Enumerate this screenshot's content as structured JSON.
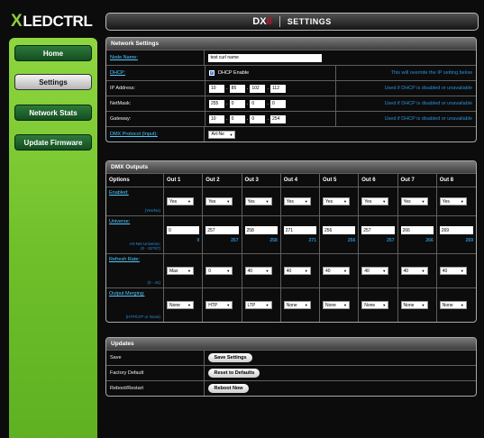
{
  "logo": {
    "x": "X",
    "text": "LEDCTRL"
  },
  "header": {
    "dx": "DX",
    "eight": "8",
    "title": "SETTINGS"
  },
  "nav": {
    "home": "Home",
    "settings": "Settings",
    "network_stats": "Network Stats",
    "update_firmware": "Update Firmware"
  },
  "network": {
    "title": "Network Settings",
    "node_name": {
      "label": "Node Name:",
      "value": "test curl name"
    },
    "dhcp": {
      "label": "DHCP:",
      "checkbox_label": "DHCP Enable",
      "checked": true,
      "note": "This will override the IP setting below"
    },
    "ip": {
      "label": "IP Address:",
      "octets": [
        "10",
        "85",
        "102",
        "112"
      ],
      "note": "Used if DHCP is disabled or unavailable"
    },
    "netmask": {
      "label": "NetMask:",
      "octets": [
        "255",
        "0",
        "0",
        "0"
      ],
      "note": "Used if DHCP is disabled or unavailable"
    },
    "gateway": {
      "label": "Gateway:",
      "octets": [
        "10",
        "0",
        "0",
        "254"
      ],
      "note": "Used if DHCP is disabled or unavailable"
    },
    "protocol": {
      "label": "DMX Protocol (Input):",
      "value": "Art-Ne"
    }
  },
  "dmx": {
    "title": "DMX Outputs",
    "options_header": "Options",
    "outputs": [
      "Out 1",
      "Out 2",
      "Out 3",
      "Out 4",
      "Out 5",
      "Out 6",
      "Out 7",
      "Out 8"
    ],
    "enabled": {
      "label": "Enabled:",
      "sub": "(Yes/No)",
      "values": [
        "Yes",
        "Yes",
        "Yes",
        "Yes",
        "Yes",
        "Yes",
        "Yes",
        "Yes"
      ]
    },
    "universe": {
      "label": "Universe:",
      "sub1": "Art-Net Universe:",
      "sub2": "(0 - 32767)",
      "values": [
        "0",
        "257",
        "258",
        "271",
        "256",
        "257",
        "266",
        "269"
      ],
      "artnet": [
        "0",
        "257",
        "258",
        "271",
        "256",
        "257",
        "266",
        "269"
      ]
    },
    "refresh": {
      "label": "Refresh Rate:",
      "sub": "(0 - 44)",
      "values": [
        "Max",
        "0",
        "40",
        "40",
        "40",
        "40",
        "40",
        "40"
      ]
    },
    "merging": {
      "label": "Output Merging:",
      "sub": "(HTP/LTP or None)",
      "values": [
        "None",
        "HTP",
        "LTP",
        "None",
        "None",
        "None",
        "None",
        "None"
      ]
    }
  },
  "updates": {
    "title": "Updates",
    "save": {
      "label": "Save",
      "button": "Save Settings"
    },
    "factory": {
      "label": "Factory Default",
      "button": "Reset to Defaults"
    },
    "reboot": {
      "label": "Reboot/Restart",
      "button": "Reboot Now"
    }
  }
}
